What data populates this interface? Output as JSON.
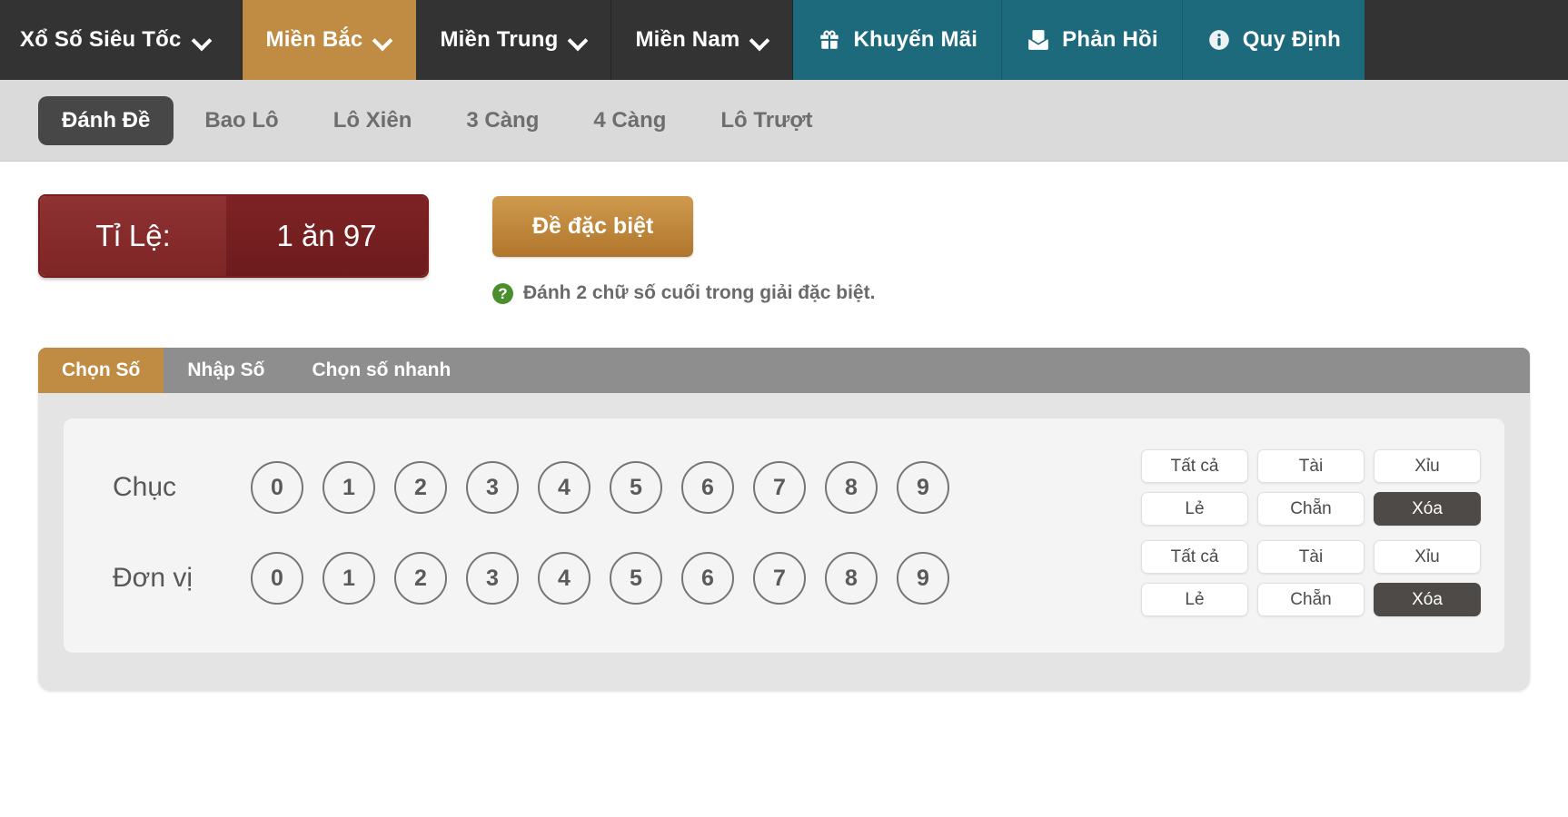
{
  "topnav": {
    "items": [
      {
        "label": "Xổ Số Siêu Tốc",
        "icon": "chevron-down-icon",
        "style": "brand"
      },
      {
        "label": "Miền Bắc",
        "icon": "chevron-down-icon",
        "style": "active-gold"
      },
      {
        "label": "Miền Trung",
        "icon": "chevron-down-icon",
        "style": "dark"
      },
      {
        "label": "Miền Nam",
        "icon": "chevron-down-icon",
        "style": "dark"
      },
      {
        "label": "Khuyến Mãi",
        "icon": "gift-icon",
        "style": "teal"
      },
      {
        "label": "Phản Hồi",
        "icon": "feedback-envelope-icon",
        "style": "teal"
      },
      {
        "label": "Quy Định",
        "icon": "info-circle-icon",
        "style": "teal"
      }
    ]
  },
  "subtabs": {
    "items": [
      {
        "label": "Đánh Đề",
        "active": true
      },
      {
        "label": "Bao Lô",
        "active": false
      },
      {
        "label": "Lô Xiên",
        "active": false
      },
      {
        "label": "3 Càng",
        "active": false
      },
      {
        "label": "4 Càng",
        "active": false
      },
      {
        "label": "Lô Trượt",
        "active": false
      }
    ]
  },
  "rate": {
    "label": "Tỉ Lệ:",
    "value": "1 ăn 97"
  },
  "actions": {
    "special_button": "Đề đặc biệt",
    "hint_icon": "?",
    "hint_text": "Đánh 2 chữ số cuối trong giải đặc biệt."
  },
  "panel": {
    "tabs": [
      {
        "label": "Chọn Số",
        "active": true
      },
      {
        "label": "Nhập Số",
        "active": false
      },
      {
        "label": "Chọn số nhanh",
        "active": false
      }
    ],
    "rows": [
      {
        "label": "Chục",
        "digits": [
          "0",
          "1",
          "2",
          "3",
          "4",
          "5",
          "6",
          "7",
          "8",
          "9"
        ],
        "quick": [
          {
            "label": "Tất cả",
            "dark": false
          },
          {
            "label": "Tài",
            "dark": false
          },
          {
            "label": "Xỉu",
            "dark": false
          },
          {
            "label": "Lẻ",
            "dark": false
          },
          {
            "label": "Chẵn",
            "dark": false
          },
          {
            "label": "Xóa",
            "dark": true
          }
        ]
      },
      {
        "label": "Đơn vị",
        "digits": [
          "0",
          "1",
          "2",
          "3",
          "4",
          "5",
          "6",
          "7",
          "8",
          "9"
        ],
        "quick": [
          {
            "label": "Tất cả",
            "dark": false
          },
          {
            "label": "Tài",
            "dark": false
          },
          {
            "label": "Xỉu",
            "dark": false
          },
          {
            "label": "Lẻ",
            "dark": false
          },
          {
            "label": "Chẵn",
            "dark": false
          },
          {
            "label": "Xóa",
            "dark": true
          }
        ]
      }
    ]
  },
  "colors": {
    "nav_dark": "#333333",
    "nav_gold": "#c08b42",
    "nav_teal": "#1e6a7d",
    "rate_red": "#7e2526",
    "panel_gray": "#8e8e8e",
    "hint_green": "#4a8f2c"
  }
}
